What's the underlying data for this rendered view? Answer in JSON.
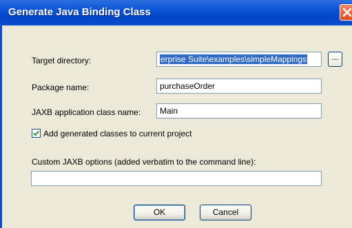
{
  "window": {
    "title": "Generate Java Binding Class"
  },
  "target_directory": {
    "label": "Target directory:",
    "value": "erprise Suite\\examples\\simpleMappings",
    "browse_label": "..."
  },
  "package_name": {
    "label": "Package name:",
    "value": "purchaseOrder"
  },
  "jaxb_class": {
    "label": "JAXB application class name:",
    "value": "Main"
  },
  "add_generated": {
    "label": "Add generated classes to current project",
    "checked": true
  },
  "custom_options": {
    "label": "Custom JAXB options (added verbatim to the command line):",
    "value": ""
  },
  "buttons": {
    "ok": "OK",
    "cancel": "Cancel"
  }
}
